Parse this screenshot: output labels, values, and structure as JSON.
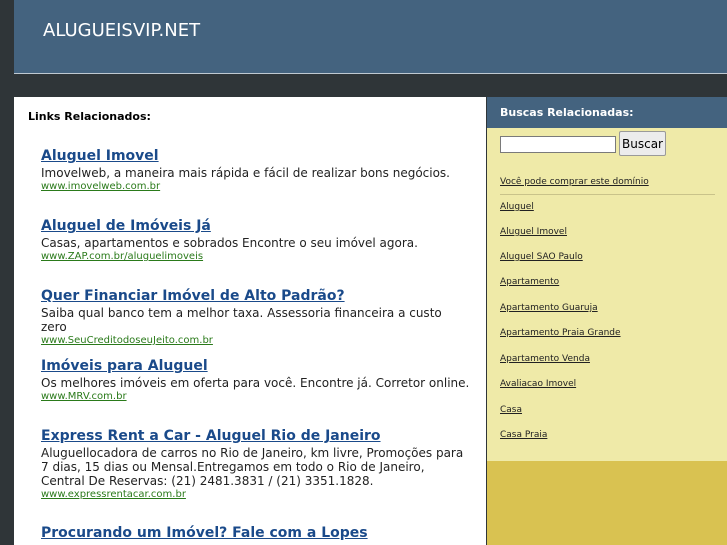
{
  "header": {
    "title": "ALUGUEISVIP.NET"
  },
  "main": {
    "heading": "Links Relacionados:",
    "ads": [
      {
        "title": "Aluguel Imovel",
        "desc": "Imovelweb, a maneira mais rápida e fácil de realizar bons negócios.",
        "url": "www.imovelweb.com.br"
      },
      {
        "title": "Aluguel de Imóveis Já",
        "desc": "Casas, apartamentos e sobrados Encontre o seu imóvel agora.",
        "url": "www.ZAP.com.br/aluguelimoveis"
      },
      {
        "title": "Quer Financiar Imóvel de Alto Padrão?",
        "desc": "Saiba qual banco tem a melhor taxa. Assessoria financeira a custo zero",
        "url": "www.SeuCreditodoseuJeito.com.br"
      },
      {
        "title": "Imóveis para Aluguel",
        "desc": "Os melhores imóveis em oferta para você. Encontre já. Corretor online.",
        "url": "www.MRV.com.br"
      },
      {
        "title": "Express Rent a Car - Aluguel Rio de Janeiro",
        "desc": "Aluguellocadora de carros no Rio de Janeiro, km livre, Promoções para 7 dias, 15 dias ou Mensal.Entregamos em todo o Rio de Janeiro, Central De Reservas: (21) 2481.3831 / (21) 3351.1828.",
        "url": "www.expressrentacar.com.br"
      },
      {
        "title": "Procurando um Imóvel? Fale com a Lopes",
        "desc": "",
        "url": ""
      }
    ]
  },
  "sidebar": {
    "title": "Buscas Relacionadas:",
    "search_value": "",
    "search_button": "Buscar",
    "items": [
      "Você pode comprar este domínio",
      "Aluguel",
      "Aluguel Imovel",
      "Aluguel SAO Paulo",
      "Apartamento",
      "Apartamento Guaruja",
      "Apartamento Praia Grande",
      "Apartamento Venda",
      "Avaliacao Imovel",
      "Casa",
      "Casa Praia"
    ]
  }
}
